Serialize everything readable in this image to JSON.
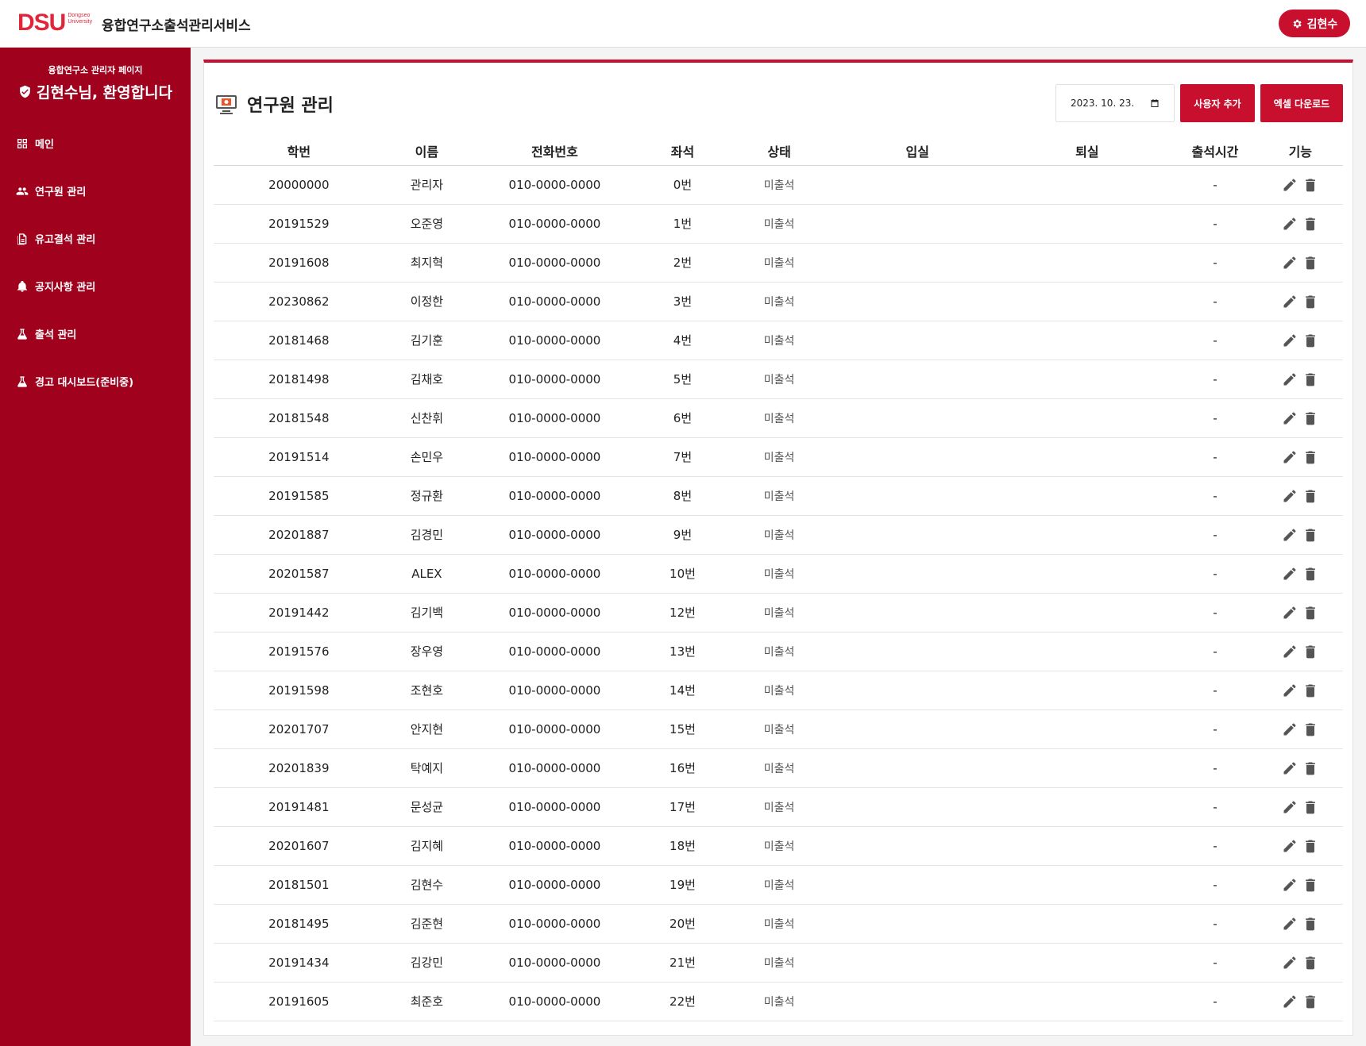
{
  "header": {
    "logo_text": "DSU",
    "logo_sub_1": "Dongseo",
    "logo_sub_2": "University",
    "app_title": "융합연구소출석관리서비스",
    "user_name": "김현수"
  },
  "sidebar": {
    "subtitle": "융합연구소 관리자 페이지",
    "welcome": "김현수님, 환영합니다",
    "items": [
      {
        "label": "메인",
        "icon": "grid-icon"
      },
      {
        "label": "연구원 관리",
        "icon": "users-icon"
      },
      {
        "label": "유고결석 관리",
        "icon": "document-icon"
      },
      {
        "label": "공지사항 관리",
        "icon": "bell-icon"
      },
      {
        "label": "출석 관리",
        "icon": "flask-icon"
      },
      {
        "label": "경고 대시보드(준비중)",
        "icon": "flask-icon"
      }
    ]
  },
  "main": {
    "title": "연구원 관리",
    "date_value": "2023. 10. 23.",
    "add_user_label": "사용자 추가",
    "excel_label": "엑셀 다운로드",
    "columns": [
      "학번",
      "이름",
      "전화번호",
      "좌석",
      "상태",
      "입실",
      "퇴실",
      "출석시간",
      "기능"
    ],
    "rows": [
      {
        "id": "20000000",
        "name": "관리자",
        "phone": "010-0000-0000",
        "seat": "0번",
        "status": "미출석",
        "checkin": "",
        "checkout": "",
        "time": "-"
      },
      {
        "id": "20191529",
        "name": "오준영",
        "phone": "010-0000-0000",
        "seat": "1번",
        "status": "미출석",
        "checkin": "",
        "checkout": "",
        "time": "-"
      },
      {
        "id": "20191608",
        "name": "최지혁",
        "phone": "010-0000-0000",
        "seat": "2번",
        "status": "미출석",
        "checkin": "",
        "checkout": "",
        "time": "-"
      },
      {
        "id": "20230862",
        "name": "이정한",
        "phone": "010-0000-0000",
        "seat": "3번",
        "status": "미출석",
        "checkin": "",
        "checkout": "",
        "time": "-"
      },
      {
        "id": "20181468",
        "name": "김기훈",
        "phone": "010-0000-0000",
        "seat": "4번",
        "status": "미출석",
        "checkin": "",
        "checkout": "",
        "time": "-"
      },
      {
        "id": "20181498",
        "name": "김채호",
        "phone": "010-0000-0000",
        "seat": "5번",
        "status": "미출석",
        "checkin": "",
        "checkout": "",
        "time": "-"
      },
      {
        "id": "20181548",
        "name": "신찬휘",
        "phone": "010-0000-0000",
        "seat": "6번",
        "status": "미출석",
        "checkin": "",
        "checkout": "",
        "time": "-"
      },
      {
        "id": "20191514",
        "name": "손민우",
        "phone": "010-0000-0000",
        "seat": "7번",
        "status": "미출석",
        "checkin": "",
        "checkout": "",
        "time": "-"
      },
      {
        "id": "20191585",
        "name": "정규환",
        "phone": "010-0000-0000",
        "seat": "8번",
        "status": "미출석",
        "checkin": "",
        "checkout": "",
        "time": "-"
      },
      {
        "id": "20201887",
        "name": "김경민",
        "phone": "010-0000-0000",
        "seat": "9번",
        "status": "미출석",
        "checkin": "",
        "checkout": "",
        "time": "-"
      },
      {
        "id": "20201587",
        "name": "ALEX",
        "phone": "010-0000-0000",
        "seat": "10번",
        "status": "미출석",
        "checkin": "",
        "checkout": "",
        "time": "-"
      },
      {
        "id": "20191442",
        "name": "김기백",
        "phone": "010-0000-0000",
        "seat": "12번",
        "status": "미출석",
        "checkin": "",
        "checkout": "",
        "time": "-"
      },
      {
        "id": "20191576",
        "name": "장우영",
        "phone": "010-0000-0000",
        "seat": "13번",
        "status": "미출석",
        "checkin": "",
        "checkout": "",
        "time": "-"
      },
      {
        "id": "20191598",
        "name": "조현호",
        "phone": "010-0000-0000",
        "seat": "14번",
        "status": "미출석",
        "checkin": "",
        "checkout": "",
        "time": "-"
      },
      {
        "id": "20201707",
        "name": "안지현",
        "phone": "010-0000-0000",
        "seat": "15번",
        "status": "미출석",
        "checkin": "",
        "checkout": "",
        "time": "-"
      },
      {
        "id": "20201839",
        "name": "탁예지",
        "phone": "010-0000-0000",
        "seat": "16번",
        "status": "미출석",
        "checkin": "",
        "checkout": "",
        "time": "-"
      },
      {
        "id": "20191481",
        "name": "문성균",
        "phone": "010-0000-0000",
        "seat": "17번",
        "status": "미출석",
        "checkin": "",
        "checkout": "",
        "time": "-"
      },
      {
        "id": "20201607",
        "name": "김지혜",
        "phone": "010-0000-0000",
        "seat": "18번",
        "status": "미출석",
        "checkin": "",
        "checkout": "",
        "time": "-"
      },
      {
        "id": "20181501",
        "name": "김현수",
        "phone": "010-0000-0000",
        "seat": "19번",
        "status": "미출석",
        "checkin": "",
        "checkout": "",
        "time": "-"
      },
      {
        "id": "20181495",
        "name": "김준현",
        "phone": "010-0000-0000",
        "seat": "20번",
        "status": "미출석",
        "checkin": "",
        "checkout": "",
        "time": "-"
      },
      {
        "id": "20191434",
        "name": "김강민",
        "phone": "010-0000-0000",
        "seat": "21번",
        "status": "미출석",
        "checkin": "",
        "checkout": "",
        "time": "-"
      },
      {
        "id": "20191605",
        "name": "최준호",
        "phone": "010-0000-0000",
        "seat": "22번",
        "status": "미출석",
        "checkin": "",
        "checkout": "",
        "time": "-"
      }
    ]
  },
  "colors": {
    "brand_red": "#c8102e",
    "sidebar_red": "#a0021d",
    "logo_red": "#e0263b"
  }
}
